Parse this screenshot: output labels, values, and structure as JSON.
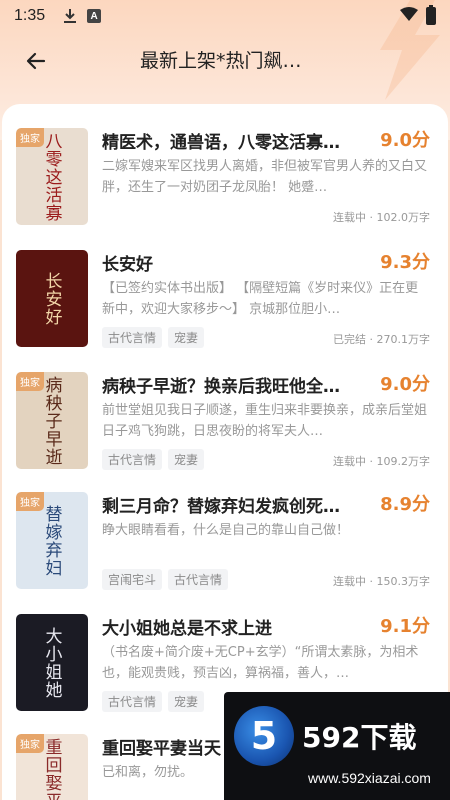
{
  "status_bar": {
    "time": "1:35",
    "a_label": "A"
  },
  "header": {
    "title": "最新上架*热门飙…"
  },
  "books": [
    {
      "title": "精医术，通兽语，八零这活寡…",
      "score": "9.0分",
      "desc": "二嫁军嫂来军区找男人离婚，非但被军官男人养的又白又胖，还生了一对奶团子龙凤胎！ 她蹙…",
      "tags": [],
      "meta": "连载中 · 102.0万字",
      "badge": "独家",
      "cover_text": "八零这活寡",
      "cover_bg": "#e9ddd0",
      "cover_fg": "#9b1b1b"
    },
    {
      "title": "长安好",
      "score": "9.3分",
      "desc": "【已签约实体书出版】 【隔壁短篇《岁时来仪》正在更新中，欢迎大家移步～】 京城那位胆小…",
      "tags": [
        "古代言情",
        "宠妻"
      ],
      "meta": "已完结 · 270.1万字",
      "badge": "",
      "cover_text": "长安好",
      "cover_bg": "#5a1410",
      "cover_fg": "#f2d6a8"
    },
    {
      "title": "病秧子早逝？换亲后我旺他全…",
      "score": "9.0分",
      "desc": "前世堂姐见我日子顺遂，重生归来非要换亲，成亲后堂姐日子鸡飞狗跳，日思夜盼的将军夫人…",
      "tags": [
        "古代言情",
        "宠妻"
      ],
      "meta": "连载中 · 109.2万字",
      "badge": "独家",
      "cover_text": "病秧子早逝",
      "cover_bg": "#e3d3bf",
      "cover_fg": "#5a2a1a"
    },
    {
      "title": "剩三月命？替嫁弃妇发疯创死…",
      "score": "8.9分",
      "desc": "睁大眼睛看看，什么是自己的靠山自己做！",
      "tags": [
        "宫闱宅斗",
        "古代言情"
      ],
      "meta": "连载中 · 150.3万字",
      "badge": "独家",
      "cover_text": "替嫁弃妇",
      "cover_bg": "#dde6ef",
      "cover_fg": "#2b4a7a"
    },
    {
      "title": "大小姐她总是不求上进",
      "score": "9.1分",
      "desc": "（书名废+简介废+无CP+玄学）“所谓太素脉，为相术也，能观贵贱，预吉凶，算祸福，善人，…",
      "tags": [
        "古代言情",
        "宠妻"
      ],
      "meta": "",
      "badge": "",
      "cover_text": "大小姐她",
      "cover_bg": "#1b1b24",
      "cover_fg": "#e8e8f0"
    },
    {
      "title": "重回娶平妻当天",
      "score": "",
      "desc": "已和离，勿扰。",
      "tags": [],
      "meta": "",
      "badge": "独家",
      "cover_text": "重回娶平妻",
      "cover_bg": "#f1e4d8",
      "cover_fg": "#8a2a2a"
    }
  ],
  "watermark": {
    "big": "592下载",
    "url": "www.592xiazai.com",
    "logo": "5"
  }
}
